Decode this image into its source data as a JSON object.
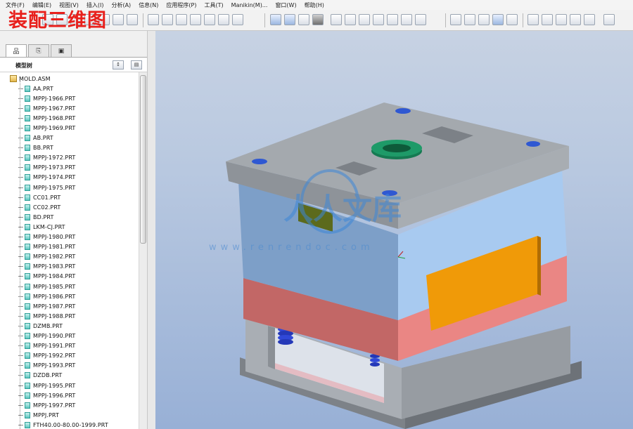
{
  "menu": [
    "文件(F)",
    "编辑(E)",
    "视图(V)",
    "插入(I)",
    "分析(A)",
    "信息(N)",
    "应用程序(P)",
    "工具(T)",
    "Manikin(M)...",
    "窗口(W)",
    "帮助(H)"
  ],
  "overlay_title": "装配三维图",
  "left_panel": {
    "tabs": [
      "品",
      "⎘",
      "▣"
    ],
    "title": "模型树",
    "root": "MOLD.ASM",
    "items": [
      "AA.PRT",
      "MPPJ-1966.PRT",
      "MPPJ-1967.PRT",
      "MPPJ-1968.PRT",
      "MPPJ-1969.PRT",
      "AB.PRT",
      "BB.PRT",
      "MPPJ-1972.PRT",
      "MPPJ-1973.PRT",
      "MPPJ-1974.PRT",
      "MPPJ-1975.PRT",
      "CC01.PRT",
      "CC02.PRT",
      "BD.PRT",
      "LKM-CJ.PRT",
      "MPPJ-1980.PRT",
      "MPPJ-1981.PRT",
      "MPPJ-1982.PRT",
      "MPPJ-1983.PRT",
      "MPPJ-1984.PRT",
      "MPPJ-1985.PRT",
      "MPPJ-1986.PRT",
      "MPPJ-1987.PRT",
      "MPPJ-1988.PRT",
      "DZMB.PRT",
      "MPPJ-1990.PRT",
      "MPPJ-1991.PRT",
      "MPPJ-1992.PRT",
      "MPPJ-1993.PRT",
      "DZDB.PRT",
      "MPPJ-1995.PRT",
      "MPPJ-1996.PRT",
      "MPPJ-1997.PRT",
      "MPPJ.PRT",
      "FTH40.00-80.00-1999.PRT"
    ]
  },
  "watermark": {
    "text": "人人文库",
    "url": "www.renrendoc.com"
  },
  "colors": {
    "top_plate": "#9ea4ab",
    "a_plate": "#a4c6ec",
    "b_plate": "#e88482",
    "orange_block": "#f09a08",
    "green_ring": "#1e9a68",
    "hole_blue": "#2f58d2",
    "watermark": "#3d87d8"
  }
}
